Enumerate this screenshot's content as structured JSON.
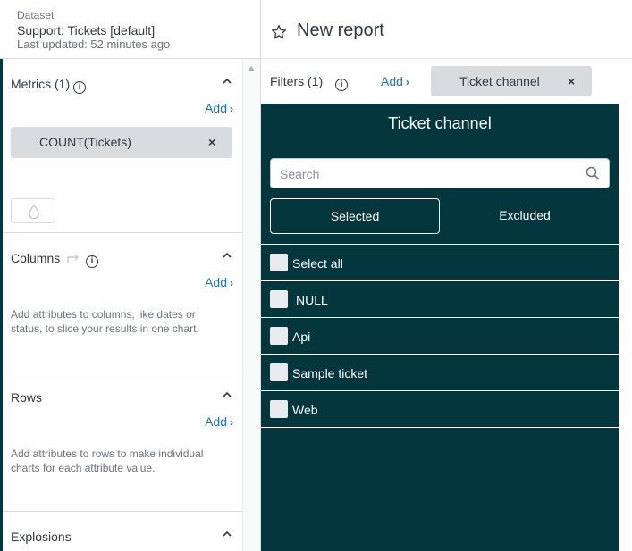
{
  "dataset": {
    "label": "Dataset",
    "name": "Support: Tickets [default]",
    "updated": "Last updated: 52 minutes ago"
  },
  "report": {
    "title": "New report"
  },
  "sidebar": {
    "metrics": {
      "title": "Metrics (1)",
      "add_label": "Add",
      "items": [
        {
          "label": "COUNT(Tickets)",
          "remove": "×"
        }
      ]
    },
    "columns": {
      "title": "Columns",
      "add_label": "Add",
      "hint": "Add attributes to columns, like dates or status, to slice your results in one chart."
    },
    "rows": {
      "title": "Rows",
      "add_label": "Add",
      "hint": "Add attributes to rows to make individual charts for each attribute value."
    },
    "explosions": {
      "title": "Explosions"
    }
  },
  "filters": {
    "title": "Filters (1)",
    "add_label": "Add",
    "chips": [
      {
        "label": "Ticket channel",
        "remove": "×"
      }
    ]
  },
  "filter_panel": {
    "title": "Ticket channel",
    "search_placeholder": "Search",
    "tabs": {
      "selected": "Selected",
      "excluded": "Excluded"
    },
    "options": [
      "Select all",
      "NULL",
      "Api",
      "Sample ticket",
      "Web"
    ]
  },
  "icons": {
    "star": "star-icon",
    "info": "info-icon",
    "search": "search-icon",
    "caret_up": "chevron-up-icon",
    "close": "close-icon",
    "swap": "swap-icon",
    "drop": "drop-icon"
  },
  "colors": {
    "panel_bg": "#03363d",
    "link": "#1f73b7",
    "chip_bg": "#d8dcde"
  }
}
